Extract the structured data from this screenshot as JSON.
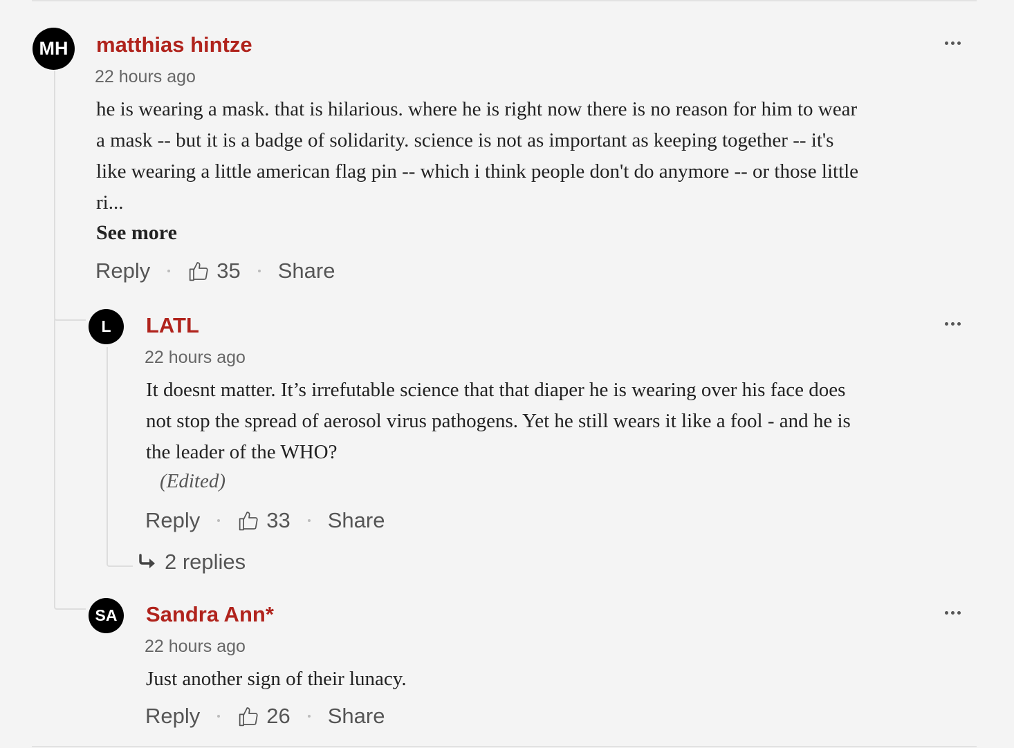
{
  "comments": [
    {
      "initials": "MH",
      "author": "matthias hintze",
      "time": "22 hours ago",
      "text_lines": [
        "he is wearing a mask. that is hilarious. where he is right now there is no reason for him to wear",
        "a mask -- but it is a badge of solidarity. science is not as important as keeping together -- it's",
        "like wearing a little american flag pin -- which i think people don't do anymore -- or those little",
        "ri..."
      ],
      "see_more": "See more",
      "reply": "Reply",
      "likes": "35",
      "share": "Share"
    },
    {
      "initials": "L",
      "author": "LATL",
      "time": "22 hours ago",
      "text_lines": [
        "It doesnt matter. It’s irrefutable science that that diaper he is wearing over his face does",
        "not stop the spread of aerosol virus pathogens. Yet he still wears it like a fool - and he is",
        "the leader of the WHO?"
      ],
      "edited": "(Edited)",
      "reply": "Reply",
      "likes": "33",
      "share": "Share",
      "replies_link": "2 replies"
    },
    {
      "initials": "SA",
      "author": "Sandra Ann*",
      "time": "22 hours ago",
      "text_lines": [
        "Just another sign of their lunacy."
      ],
      "reply": "Reply",
      "likes": "26",
      "share": "Share"
    }
  ],
  "icons": {
    "like": "thumbs-up-icon",
    "more": "more-options-icon",
    "reply_arrow": "reply-arrow-icon"
  },
  "colors": {
    "author": "#b0231c",
    "avatar_bg": "#000000",
    "background": "#f4f4f4"
  }
}
